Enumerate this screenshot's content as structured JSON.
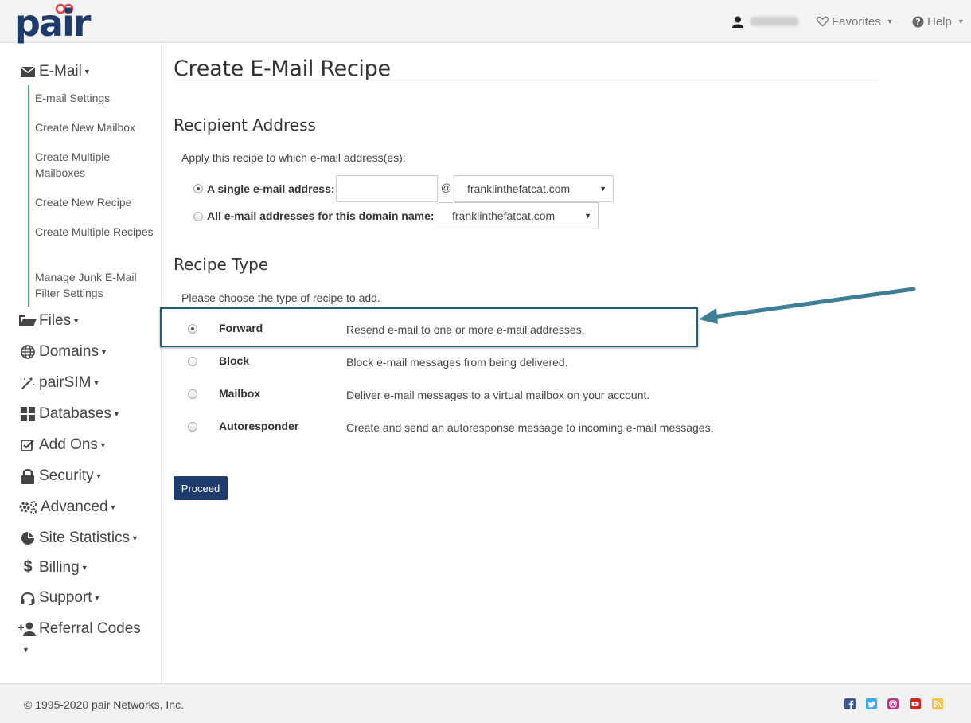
{
  "header": {
    "logo_text": "pair",
    "favorites_label": "Favorites",
    "help_label": "Help"
  },
  "sidebar": {
    "email": {
      "label": "E-Mail",
      "items": [
        {
          "label": "E-mail Settings"
        },
        {
          "label": "Create New Mailbox"
        },
        {
          "label": "Create Multiple Mailboxes"
        },
        {
          "label": "Create New Recipe"
        },
        {
          "label": "Create Multiple Recipes"
        },
        {
          "label": "Manage Junk E-Mail Filter Settings"
        }
      ]
    },
    "sections": [
      {
        "label": "Files",
        "icon": "folder-icon"
      },
      {
        "label": "Domains",
        "icon": "globe-icon"
      },
      {
        "label": "pairSIM",
        "icon": "magic-wand-icon"
      },
      {
        "label": "Databases",
        "icon": "grid-icon"
      },
      {
        "label": "Add Ons",
        "icon": "check-square-icon"
      },
      {
        "label": "Security",
        "icon": "lock-icon"
      },
      {
        "label": "Advanced",
        "icon": "gears-icon"
      },
      {
        "label": "Site Statistics",
        "icon": "pie-chart-icon"
      },
      {
        "label": "Billing",
        "icon": "dollar-icon"
      },
      {
        "label": "Support",
        "icon": "headset-icon"
      },
      {
        "label": "Referral Codes",
        "icon": "add-user-icon"
      }
    ]
  },
  "main": {
    "title": "Create E-Mail Recipe",
    "recipient": {
      "heading": "Recipient Address",
      "prompt": "Apply this recipe to which e-mail address(es):",
      "single_label": "A single e-mail address:",
      "single_value": "",
      "at_sign": "@",
      "single_domain": "franklinthefatcat.com",
      "all_label": "All e-mail addresses for this domain name:",
      "all_domain": "franklinthefatcat.com",
      "selected": "single"
    },
    "recipe_type": {
      "heading": "Recipe Type",
      "prompt": "Please choose the type of recipe to add.",
      "options": [
        {
          "name": "Forward",
          "desc": "Resend e-mail to one or more e-mail addresses.",
          "checked": true
        },
        {
          "name": "Block",
          "desc": "Block e-mail messages from being delivered.",
          "checked": false
        },
        {
          "name": "Mailbox",
          "desc": "Deliver e-mail messages to a virtual mailbox on your account.",
          "checked": false
        },
        {
          "name": "Autoresponder",
          "desc": "Create and send an autoresponse message to incoming e-mail messages.",
          "checked": false
        }
      ]
    },
    "proceed_label": "Proceed"
  },
  "footer": {
    "copyright": "© 1995-2020 pair Networks, Inc.",
    "social_icons": [
      "facebook-icon",
      "twitter-icon",
      "instagram-icon",
      "youtube-icon",
      "rss-icon"
    ]
  },
  "colors": {
    "brand_navy": "#1d3b6b",
    "submenu_accent": "#3cb878",
    "highlight_border": "#1b5f7a",
    "annotation_arrow": "#3e7e96"
  }
}
